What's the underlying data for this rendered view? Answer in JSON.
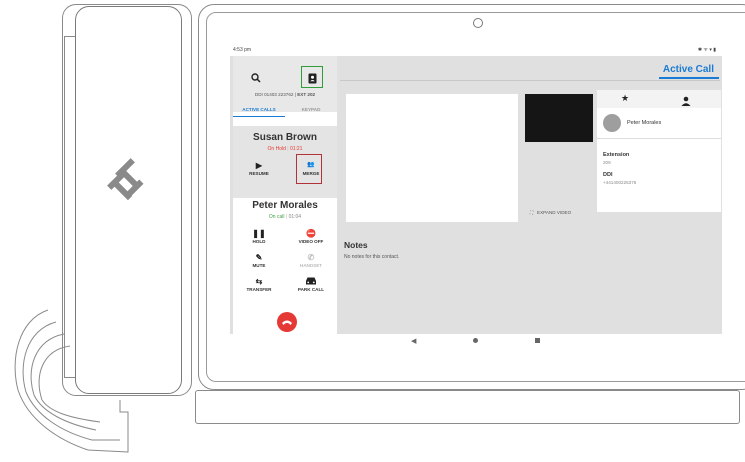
{
  "status_bar": {
    "time": "4:53 pm",
    "icons": "✱ ᯤ ▾ ▮"
  },
  "left_panel": {
    "ddi_label": "DDI 01403 223762 | ",
    "ext_label": "EXT 202",
    "tabs": [
      {
        "label": "ACTIVE CALLS",
        "active": true
      },
      {
        "label": "KEYPAD",
        "active": false
      }
    ],
    "held_call": {
      "name": "Susan Brown",
      "status": "On Hold",
      "duration": "01:21",
      "controls": [
        {
          "label": "RESUME",
          "icon": "play-icon"
        },
        {
          "label": "MERGE",
          "icon": "merge-icon"
        }
      ]
    },
    "active_call": {
      "name": "Peter Morales",
      "status": "On call",
      "duration": "01:04",
      "controls": [
        {
          "label": "HOLD",
          "icon": "pause-icon"
        },
        {
          "label": "VIDEO OFF",
          "icon": "video-off-icon"
        },
        {
          "label": "MUTE",
          "icon": "mic-off-icon"
        },
        {
          "label": "HANDSET",
          "icon": "handset-icon",
          "disabled": true
        },
        {
          "label": "TRANSFER",
          "icon": "transfer-icon"
        },
        {
          "label": "PARK CALL",
          "icon": "car-icon"
        }
      ]
    }
  },
  "main": {
    "title": "Active Call",
    "expand_video": "EXPAND VIDEO",
    "contact": {
      "name": "Peter Morales",
      "extension_label": "Extension",
      "extension_value": "209",
      "ddi_label": "DDI",
      "ddi_value": "+441400225376"
    },
    "notes_title": "Notes",
    "notes_text": "No notes for this contact."
  },
  "colors": {
    "accent": "#1a7bd6",
    "hold": "#e53935",
    "oncall": "#43a047",
    "highlight_green": "#2e9d3a",
    "highlight_red": "#b0333a"
  }
}
